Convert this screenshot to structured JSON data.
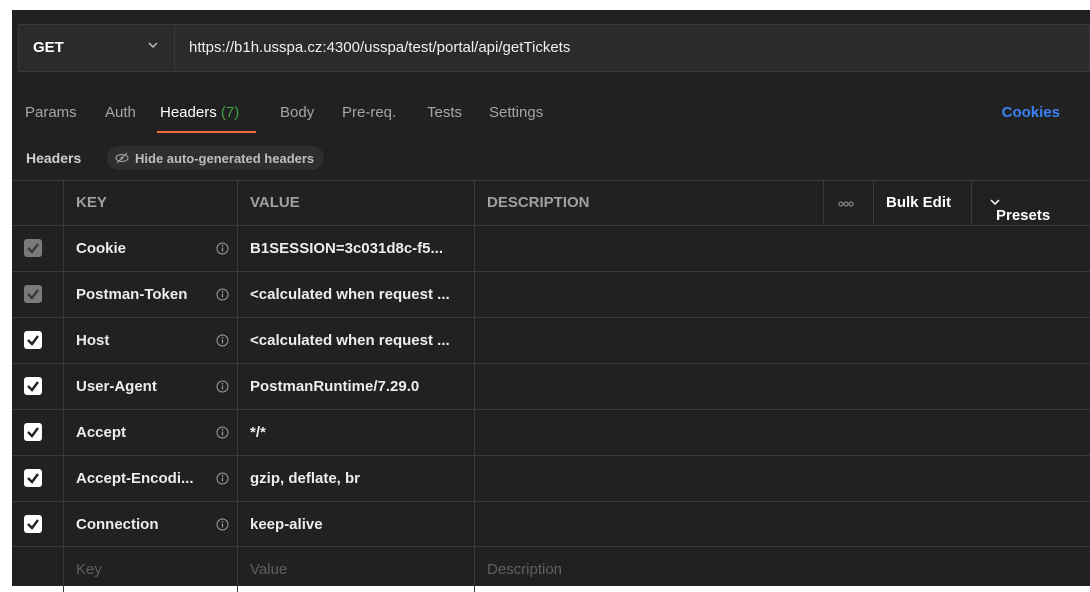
{
  "request": {
    "method": "GET",
    "url": "https://b1h.usspa.cz:4300/usspa/test/portal/api/getTickets"
  },
  "tabs": {
    "params": "Params",
    "auth": "Auth",
    "headers": "Headers",
    "headers_count": "(7)",
    "body": "Body",
    "prereq": "Pre-req.",
    "tests": "Tests",
    "settings": "Settings",
    "cookies": "Cookies"
  },
  "subbar": {
    "title": "Headers",
    "hide_label": "Hide auto-generated headers"
  },
  "table": {
    "columns": {
      "key": "KEY",
      "value": "VALUE",
      "description": "DESCRIPTION",
      "bulk_edit": "Bulk Edit",
      "presets": "Presets"
    },
    "rows": [
      {
        "key": "Cookie",
        "value": "B1SESSION=3c031d8c-f5...",
        "state": "disabled"
      },
      {
        "key": "Postman-Token",
        "value": "<calculated when request ...",
        "state": "disabled"
      },
      {
        "key": "Host",
        "value": "<calculated when request ...",
        "state": "checked"
      },
      {
        "key": "User-Agent",
        "value": "PostmanRuntime/7.29.0",
        "state": "checked"
      },
      {
        "key": "Accept",
        "value": "*/*",
        "state": "checked"
      },
      {
        "key": "Accept-Encodi...",
        "value": "gzip, deflate, br",
        "state": "checked"
      },
      {
        "key": "Connection",
        "value": "keep-alive",
        "state": "checked"
      }
    ],
    "placeholders": {
      "key": "Key",
      "value": "Value",
      "description": "Description"
    }
  },
  "colors": {
    "background": "#212121",
    "accent_tab": "#f26b3a",
    "count_green": "#43a047",
    "cookies_blue": "#3b82f6"
  },
  "icons": [
    "chevron-down-icon",
    "eye-off-icon",
    "info-icon",
    "checkbox-icon",
    "more-dots-icon"
  ]
}
